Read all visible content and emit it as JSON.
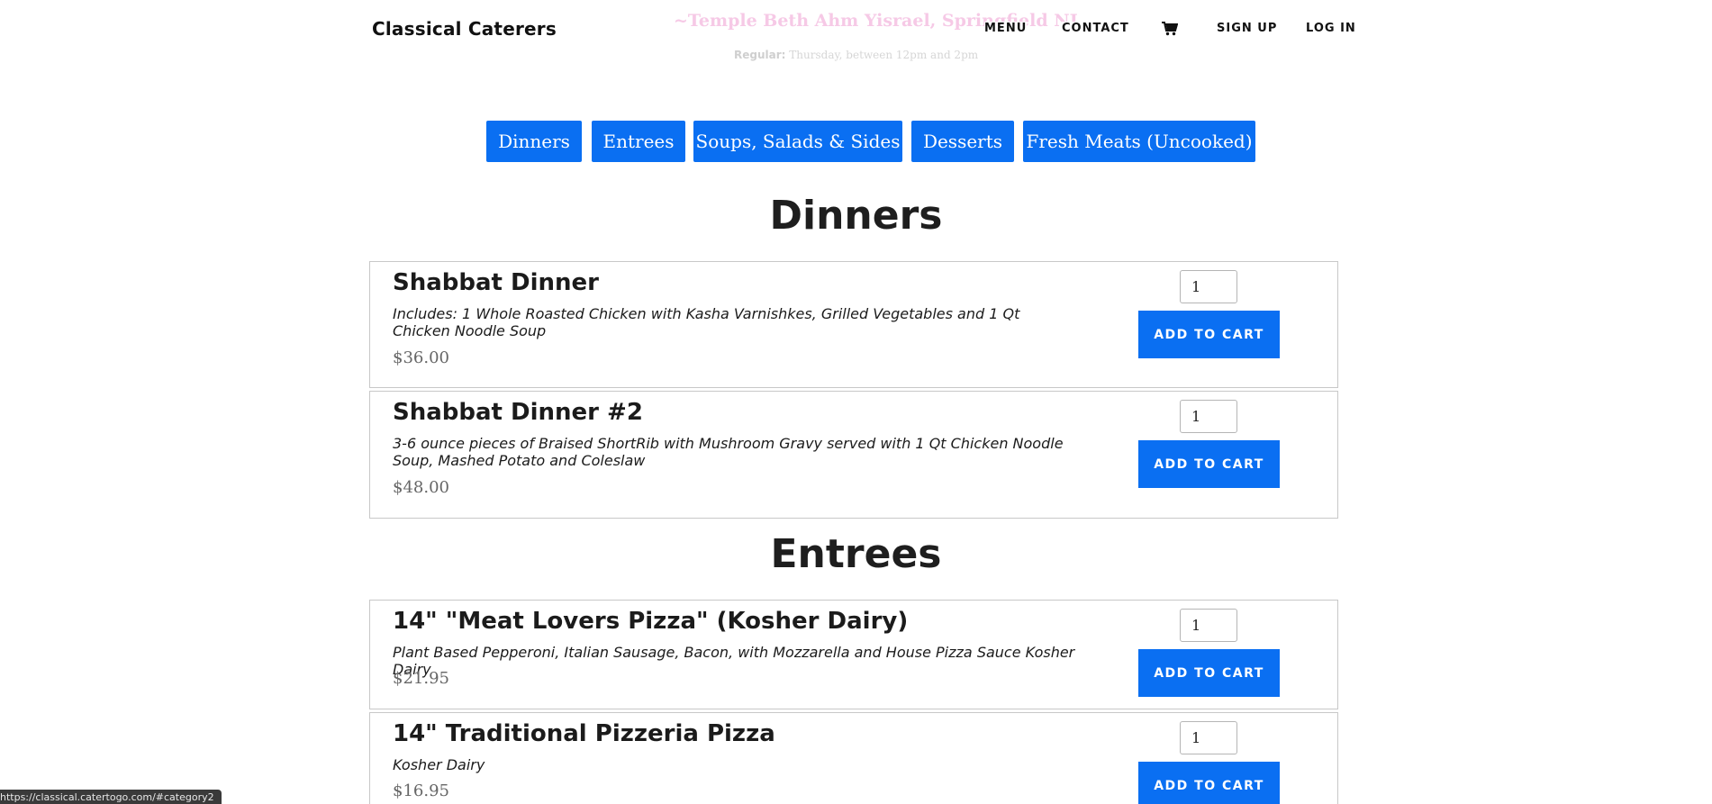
{
  "header": {
    "brand": "Classical Caterers",
    "location": "~Temple Beth Ahm Yisrael, Springfield NJ",
    "schedule_label": "Regular:",
    "schedule_text": "Thursday, between 12pm and 2pm",
    "nav": {
      "menu": "MENU",
      "contact": "CONTACT",
      "cart_icon": "shopping-cart-icon",
      "sign_up": "SIGN UP",
      "log_in": "LOG IN"
    }
  },
  "categories": [
    "Dinners",
    "Entrees",
    "Soups, Salads & Sides",
    "Desserts",
    "Fresh Meats (Uncooked)"
  ],
  "sections": {
    "dinners": {
      "title": "Dinners",
      "items": [
        {
          "name": "Shabbat Dinner",
          "description": "Includes: 1 Whole Roasted Chicken with Kasha Varnishkes, Grilled Vegetables and 1 Qt Chicken Noodle Soup",
          "price": "$36.00",
          "qty": "1",
          "button": "ADD TO CART"
        },
        {
          "name": "Shabbat Dinner #2",
          "description": "3-6 ounce pieces of Braised ShortRib with Mushroom Gravy served with 1 Qt Chicken Noodle Soup, Mashed Potato and Coleslaw",
          "price": "$48.00",
          "qty": "1",
          "button": "ADD TO CART"
        }
      ]
    },
    "entrees": {
      "title": "Entrees",
      "items": [
        {
          "name": "14\" \"Meat Lovers Pizza\" (Kosher Dairy)",
          "description": "Plant Based Pepperoni, Italian Sausage, Bacon, with Mozzarella and House Pizza Sauce Kosher Dairy",
          "price": "$21.95",
          "qty": "1",
          "button": "ADD TO CART"
        },
        {
          "name": "14\" Traditional Pizzeria Pizza",
          "description": "Kosher Dairy",
          "price": "$16.95",
          "qty": "1",
          "button": "ADD TO CART"
        }
      ]
    }
  },
  "status_bar": {
    "url": "https://classical.catertogo.com/#category2"
  },
  "colors": {
    "accent": "#0a6ff2",
    "heading": "#1e1e1e",
    "price": "#666666",
    "faded_location": "#f6c9e6"
  }
}
